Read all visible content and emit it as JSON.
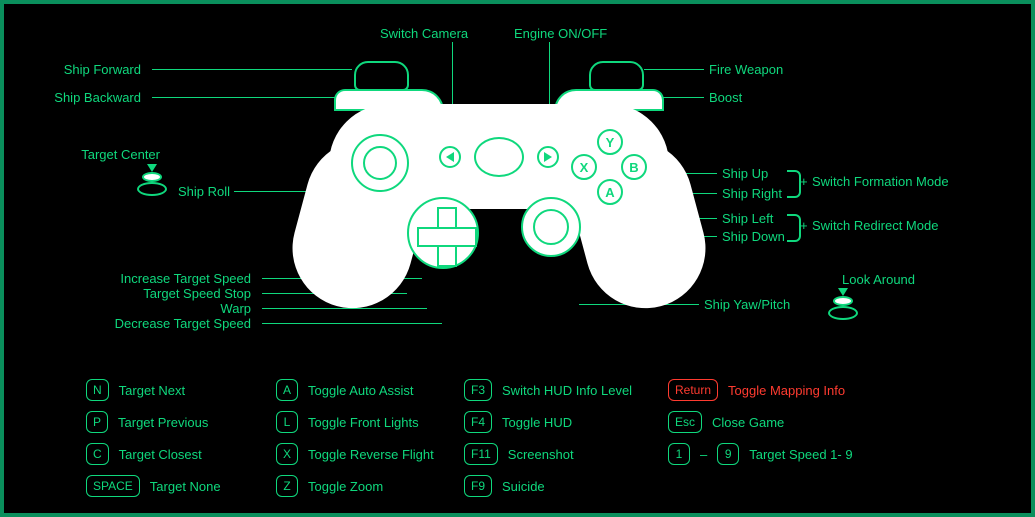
{
  "labels": {
    "switch_camera": "Switch Camera",
    "engine_on_off": "Engine ON/OFF",
    "ship_forward": "Ship Forward",
    "ship_backward": "Ship Backward",
    "fire_weapon": "Fire Weapon",
    "boost": "Boost",
    "target_center": "Target Center",
    "ship_roll": "Ship Roll",
    "ship_up": "Ship Up",
    "ship_right": "Ship Right",
    "ship_left": "Ship Left",
    "ship_down": "Ship Down",
    "switch_formation": "Switch Formation Mode",
    "switch_redirect": "Switch Redirect Mode",
    "increase_target_speed": "Increase Target Speed",
    "target_speed_stop": "Target Speed Stop",
    "warp": "Warp",
    "decrease_target_speed": "Decrease Target Speed",
    "ship_yaw_pitch": "Ship Yaw/Pitch",
    "look_around": "Look Around",
    "plus1": "+",
    "plus2": "+"
  },
  "buttons": {
    "y": "Y",
    "b": "B",
    "x": "X",
    "a": "A"
  },
  "keys": {
    "col1": [
      {
        "key": "N",
        "label": "Target Next"
      },
      {
        "key": "P",
        "label": "Target Previous"
      },
      {
        "key": "C",
        "label": "Target Closest"
      },
      {
        "key": "SPACE",
        "label": "Target None"
      }
    ],
    "col2": [
      {
        "key": "A",
        "label": "Toggle Auto Assist"
      },
      {
        "key": "L",
        "label": "Toggle Front Lights"
      },
      {
        "key": "X",
        "label": "Toggle Reverse Flight"
      },
      {
        "key": "Z",
        "label": "Toggle Zoom"
      }
    ],
    "col3": [
      {
        "key": "F3",
        "label": "Switch HUD Info Level"
      },
      {
        "key": "F4",
        "label": "Toggle HUD"
      },
      {
        "key": "F11",
        "label": "Screenshot"
      },
      {
        "key": "F9",
        "label": "Suicide"
      }
    ],
    "col4": [
      {
        "key": "Return",
        "label": "Toggle Mapping Info",
        "hot": true
      },
      {
        "key": "Esc",
        "label": "Close Game"
      },
      {
        "key": "1",
        "key2": "9",
        "label": "Target Speed 1- 9"
      }
    ]
  }
}
